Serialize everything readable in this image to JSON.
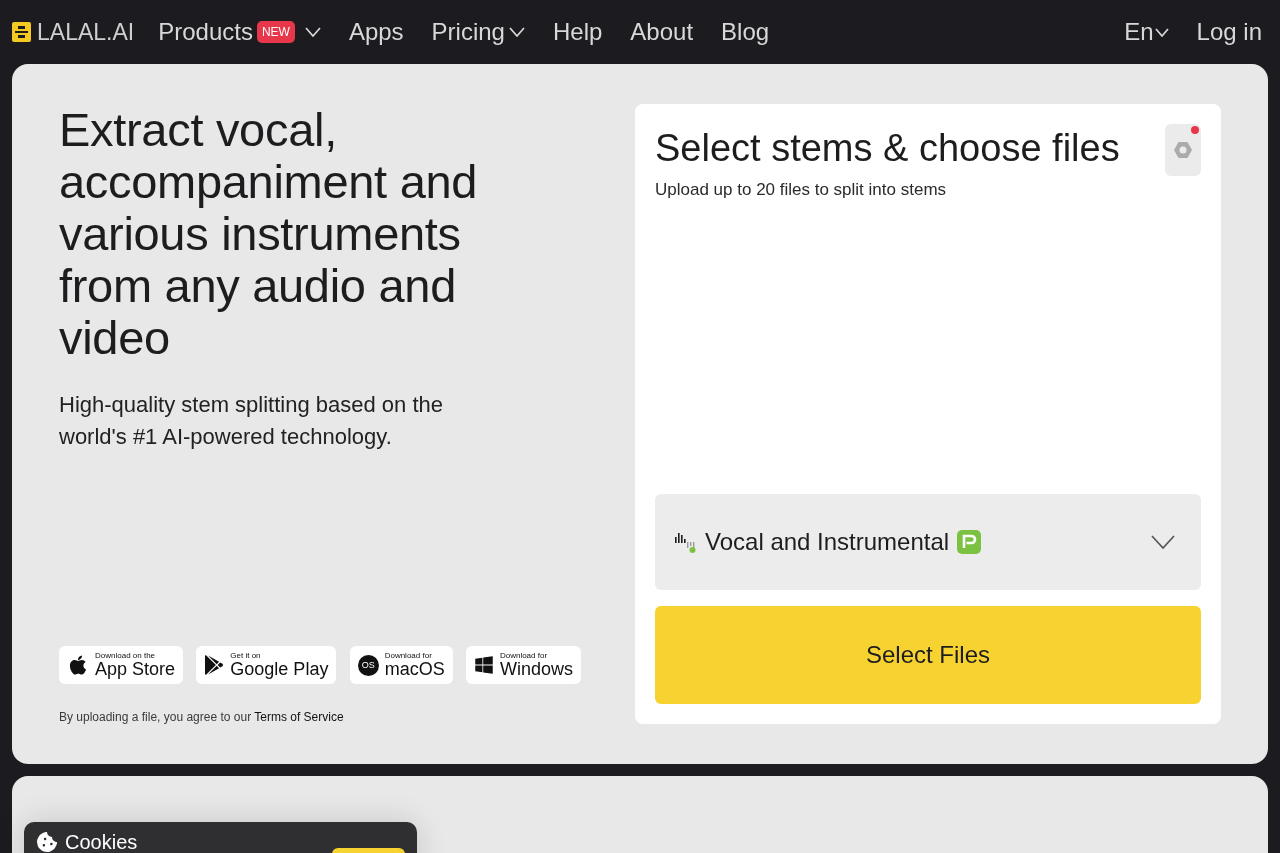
{
  "nav": {
    "logo": "LALAL.AI",
    "items": [
      {
        "label": "Products",
        "badge": "NEW",
        "has_menu": true
      },
      {
        "label": "Apps",
        "has_menu": false
      },
      {
        "label": "Pricing",
        "has_menu": true
      },
      {
        "label": "Help",
        "has_menu": false
      },
      {
        "label": "About",
        "has_menu": false
      },
      {
        "label": "Blog",
        "has_menu": false
      }
    ],
    "language": {
      "label": "En",
      "has_menu": true
    },
    "login": "Log in"
  },
  "hero": {
    "heading": "Extract vocal, accompaniment and various instruments from any audio and video",
    "subheading": "High-quality stem splitting based on the world's #1 AI-powered technology.",
    "downloads": [
      {
        "kind": "apple",
        "caption": "Download on the",
        "label": "App Store"
      },
      {
        "kind": "google-play",
        "caption": "Get it on",
        "label": "Google Play"
      },
      {
        "kind": "macos",
        "caption": "Download for",
        "label": "macOS",
        "icon_text": "OS"
      },
      {
        "kind": "windows",
        "caption": "Download for",
        "label": "Windows"
      }
    ],
    "terms": {
      "text": "By uploading a file, you agree to our ",
      "link": "Terms of Service"
    }
  },
  "upload": {
    "title": "Select stems & choose files",
    "subtitle": "Upload up to 20 files to split into stems",
    "settings": {
      "notification": true
    },
    "stem_select": {
      "label": "Vocal and Instrumental",
      "p_badge": true
    },
    "button": "Select Files"
  },
  "cookie_banner": {
    "title": "Cookies"
  }
}
